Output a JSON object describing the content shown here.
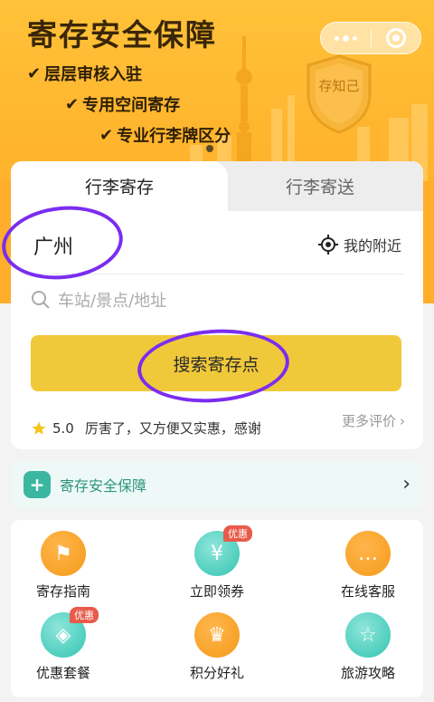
{
  "banner": {
    "title": "寄存安全保障",
    "features": [
      "层层审核入驻",
      "专用空间寄存",
      "专业行李牌区分"
    ],
    "badge_text": "存知己"
  },
  "capsule": {
    "more_icon": "more-dots-icon",
    "close_icon": "target-close-icon"
  },
  "tabs": [
    {
      "label": "行李寄存",
      "active": true
    },
    {
      "label": "行李寄送",
      "active": false
    }
  ],
  "location": {
    "city": "广州",
    "nearby_label": "我的附近"
  },
  "search": {
    "placeholder": "车站/景点/地址",
    "button_label": "搜索寄存点"
  },
  "review": {
    "rating": "5.0",
    "text": "厉害了，又方便又实惠，感谢",
    "more_label": "更多评价"
  },
  "safety": {
    "label": "寄存安全保障"
  },
  "grid": [
    {
      "label": "寄存指南",
      "icon": "signpost-icon",
      "color": "orange",
      "badge": ""
    },
    {
      "label": "立即领券",
      "icon": "ticket-icon",
      "color": "teal",
      "badge": "优惠"
    },
    {
      "label": "在线客服",
      "icon": "chat-icon",
      "color": "orange",
      "badge": ""
    },
    {
      "label": "优惠套餐",
      "icon": "tag-icon",
      "color": "teal",
      "badge": "优惠"
    },
    {
      "label": "积分好礼",
      "icon": "crown-icon",
      "color": "orange",
      "badge": ""
    },
    {
      "label": "旅游攻略",
      "icon": "book-icon",
      "color": "teal",
      "badge": ""
    }
  ],
  "colors": {
    "accent": "#f0c93a",
    "banner": "#ffb52e",
    "teal": "#33c4b2",
    "highlight": "#7a2df0"
  }
}
